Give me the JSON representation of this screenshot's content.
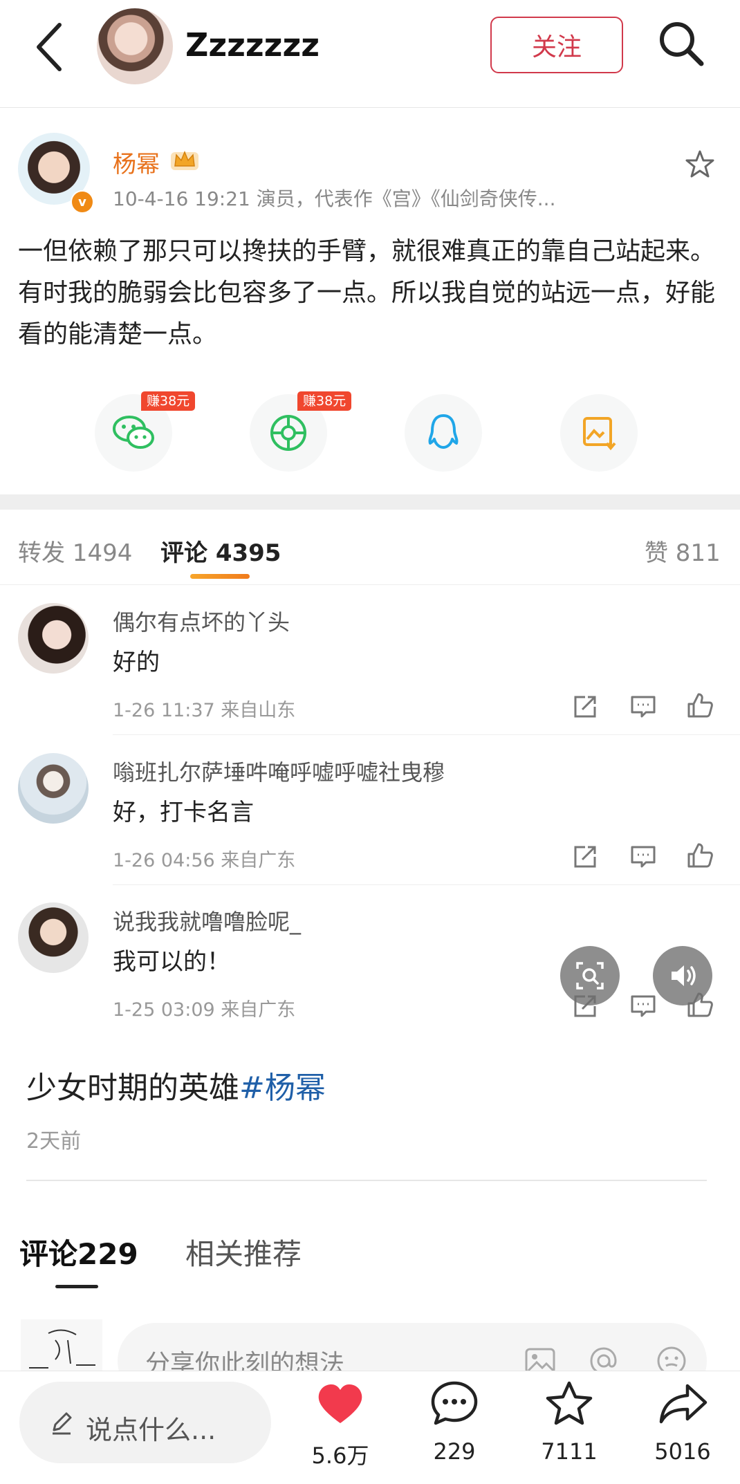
{
  "header": {
    "name": "Zzzzzzz",
    "follow_label": "关注"
  },
  "post": {
    "author": "杨幂",
    "verified_mark": "v",
    "meta": "10-4-16 19:21  演员，代表作《宫》《仙剑奇侠传...",
    "text": "一但依赖了那只可以搀扶的手臂，就很难真正的靠自己站起来。有时我的脆弱会比包容多了一点。所以我自觉的站远一点，好能看的能清楚一点。",
    "share": [
      {
        "icon": "wechat-icon",
        "badge": "赚38元",
        "color": "#2fbf60"
      },
      {
        "icon": "moments-icon",
        "badge": "赚38元",
        "color": "#2fbf60"
      },
      {
        "icon": "qq-icon",
        "badge": "",
        "color": "#20a6e8"
      },
      {
        "icon": "save-image-icon",
        "badge": "",
        "color": "#f2a526"
      }
    ]
  },
  "tabs": {
    "repost": "转发 1494",
    "comments": "评论 4395",
    "likes": "赞 811"
  },
  "comments": [
    {
      "name": "偶尔有点坏的丫头",
      "text": "好的",
      "meta": "1-26 11:37  来自山东"
    },
    {
      "name": "嗡班扎尔萨埵吽唵呼嘘呼嘘社曳穆",
      "text": "好，打卡名言",
      "meta": "1-26 04:56  来自广东"
    },
    {
      "name": "说我我就噜噜脸呢_",
      "text": "我可以的！",
      "meta": "1-25 03:09  来自广东"
    }
  ],
  "lower": {
    "title": "少女时期的英雄",
    "hashtag": "#杨幂",
    "time": "2天前",
    "tab_comments": "评论229",
    "tab_related": "相关推荐",
    "composer_placeholder": "分享你此刻的想法"
  },
  "bottom": {
    "say_placeholder": "说点什么...",
    "likes": "5.6万",
    "comments": "229",
    "favorites": "7111",
    "shares": "5016"
  }
}
